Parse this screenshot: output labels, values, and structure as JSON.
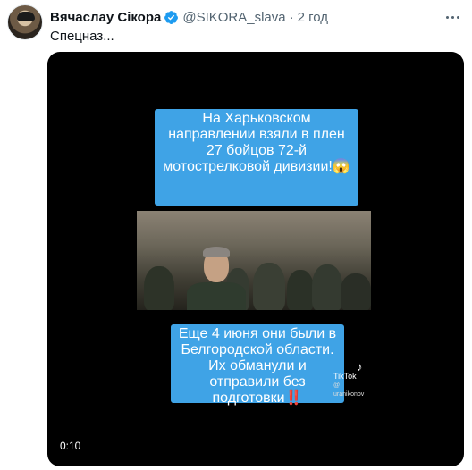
{
  "author": {
    "name": "Вячаслау Сікора",
    "handle": "@SIKORA_slava",
    "separator": "·",
    "time": "2 год"
  },
  "tweet_text": "Спецназ...",
  "video": {
    "caption_top": "На Харьковском направлении взяли в плен 27 бойцов 72-й мотострелковой дивизии!😱",
    "caption_bottom": "Еще 4 июня они были в Белгородской области. Их обманули и отправили без подготовки‼️",
    "watermark_logo": "TikTok",
    "watermark_user": "@ uranikonov",
    "duration": "0:10"
  },
  "colors": {
    "verified": "#1d9bf0",
    "caption_bg": "#3fa3e6",
    "secondary_text": "#536471"
  }
}
